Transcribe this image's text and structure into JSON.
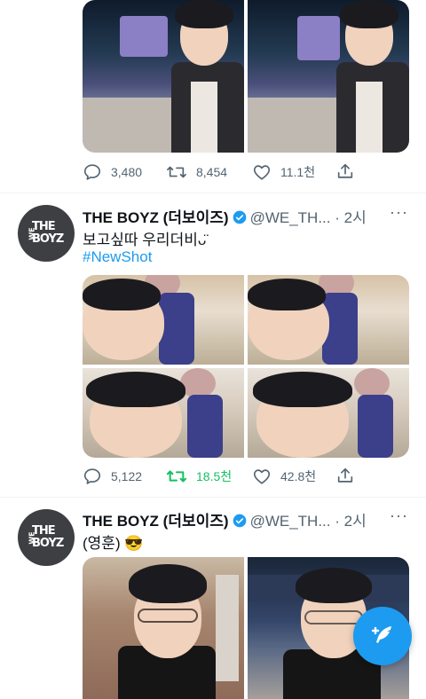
{
  "tweet1": {
    "actions": {
      "reply_count": "3,480",
      "retweet_count": "8,454",
      "like_count": "11.1천"
    }
  },
  "tweet2": {
    "avatar_text": "THE BOYZ",
    "avatar_small": "WE",
    "name": "THE BOYZ (더보이즈)",
    "handle": "@WE_TH...",
    "time": "· 2시",
    "more": "···",
    "text": "보고싶따 우리더비ᴗ̈",
    "hashtag": "#NewShot",
    "actions": {
      "reply_count": "5,122",
      "retweet_count": "18.5천",
      "like_count": "42.8천"
    }
  },
  "tweet3": {
    "avatar_text": "THE BOYZ",
    "avatar_small": "WE",
    "name": "THE BOYZ (더보이즈)",
    "handle": "@WE_TH...",
    "time": "· 2시",
    "more": "···",
    "text": "(영훈) 😎"
  },
  "colors": {
    "accent": "#1d9bf0",
    "retweet_active": "#17bf63",
    "muted": "#536471"
  },
  "icons": [
    "reply-icon",
    "retweet-icon",
    "like-icon",
    "share-icon",
    "verified-icon",
    "compose-icon"
  ]
}
